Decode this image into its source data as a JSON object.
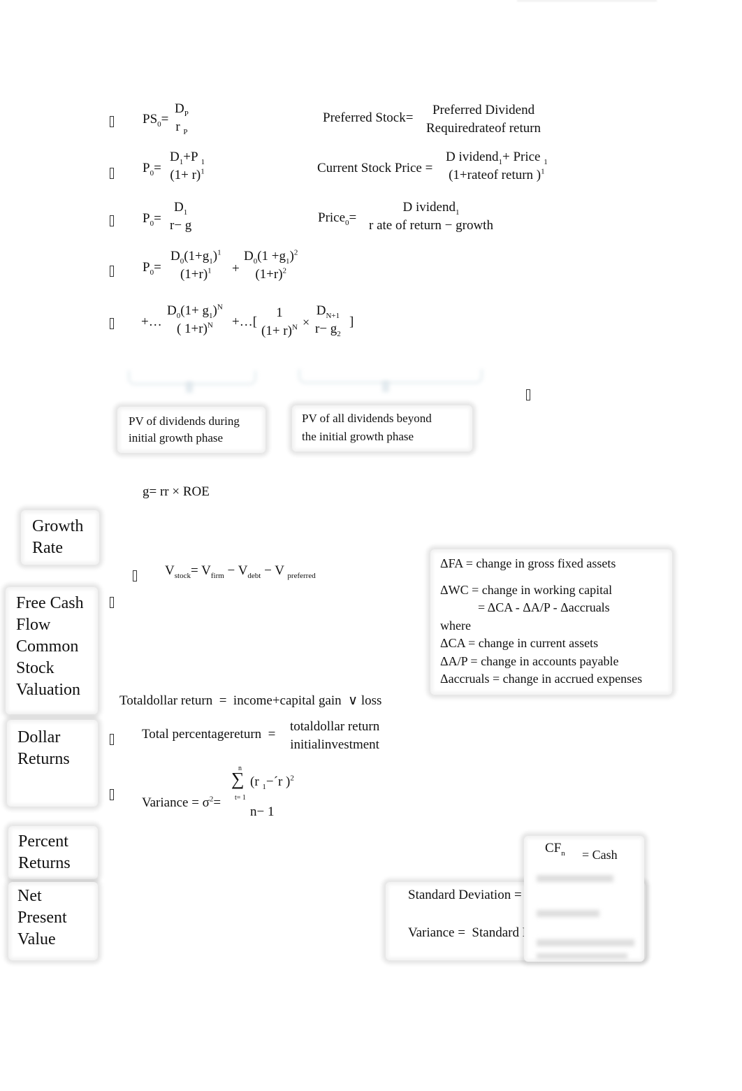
{
  "formulas": {
    "preferred_stock": {
      "lhs": "PS",
      "lhs_sub": "0",
      "eq": "=",
      "num": "D",
      "num_sub": "P",
      "den": "r",
      "den_sub": "P",
      "word_lhs": "Preferred Stock",
      "word_num": "Preferred Dividend",
      "word_den": "Requiredrateof return"
    },
    "one_period": {
      "lhs": "P",
      "lhs_sub": "0",
      "eq": "=",
      "num_a": "D",
      "num_a_sub": "1",
      "plus": "+",
      "num_b": "P",
      "num_b_sub": "1",
      "den": "(1+ r)",
      "den_sup": "1",
      "word_lhs": "Current Stock Price",
      "word_num_a": "D ividend",
      "word_num_a_sub": "1",
      "word_plus": "+",
      "word_num_b": "Price",
      "word_num_b_sub": "1",
      "word_den": "(1+rateof return )",
      "word_den_sup": "1"
    },
    "constant_growth": {
      "lhs": "P",
      "lhs_sub": "0",
      "eq": "=",
      "num": "D",
      "num_sub": "1",
      "den": "r− g",
      "word_lhs": "Price",
      "word_lhs_sub": "0",
      "word_num": "D ividend",
      "word_num_sub": "1",
      "word_den": "r ate of return − growth"
    },
    "nonconstant_1": {
      "lhs": "P",
      "lhs_sub": "0",
      "eq": "=",
      "t1_num": "D",
      "t1_num_sub": "0",
      "t1_num_rest": "(1+g",
      "t1_g_sub": "1",
      "t1_close": ")",
      "t1_sup": "1",
      "t1_den": "(1+r)",
      "t1_den_sup": "1",
      "plus": "+",
      "t2_num": "D",
      "t2_num_sub": "0",
      "t2_num_rest": "(1 +g",
      "t2_g_sub": "1",
      "t2_close": ")",
      "t2_sup": "2",
      "t2_den": "(1+r)",
      "t2_den_sup": "2"
    },
    "nonconstant_2": {
      "prefix": "+…",
      "t_num": "D",
      "t_num_sub": "0",
      "t_num_rest": "(1+ g",
      "t_g_sub": "1",
      "t_close": ")",
      "t_sup": "N",
      "t_den": "( 1+r)",
      "t_den_sup": "N",
      "mid": "+…[",
      "f_num": "1",
      "f_den": "(1+ r)",
      "f_den_sup": "N",
      "times": "×",
      "g_num": "D",
      "g_num_sub": "N+1",
      "g_den": "r− g",
      "g_den_sub": "2",
      "close": "]"
    },
    "growth_rate": {
      "text": "g= rr × ROE"
    },
    "fcf": {
      "v": "V",
      "stock": "stock",
      "eq": "=",
      "firm": "firm",
      "minus1": "−",
      "debt": "debt",
      "minus2": "−",
      "preferred": "preferred"
    },
    "total_dollar_return": {
      "text": "Totaldollar return  =  income+capital gain  ∨ loss"
    },
    "total_percentage_return": {
      "lhs": "Total percentagereturn  =",
      "num": "totaldollar return",
      "den": "initialinvestment"
    },
    "variance": {
      "lhs": "Variance = σ",
      "lhs_sup": "2",
      "eq": "=",
      "sigma": "∑",
      "sigma_top": "n",
      "sigma_bottom": "t= 1",
      "num": "(r",
      "num_sub": "1",
      "num_rest": "−´r )",
      "num_sup": "2",
      "den": "n− 1"
    },
    "std_dev": {
      "line1": "Standard Deviation =",
      "line2": "Variance =  Standard Deviation"
    },
    "cash_flow": {
      "cf": "CF",
      "cf_sub": "n",
      "eq": "= Cash"
    }
  },
  "callouts": {
    "initial_phase": {
      "line1": "PV of dividends during",
      "line2": "initial growth phase"
    },
    "beyond_phase": {
      "line1": "PV of all dividends beyond",
      "line2": "the initial growth phase"
    }
  },
  "section_labels": {
    "growth_rate": [
      "Growth",
      "Rate"
    ],
    "fcf_valuation": [
      "Free Cash",
      "Flow",
      "Common",
      "Stock",
      "Valuation"
    ],
    "dollar_returns": [
      "Dollar",
      "Returns"
    ],
    "percent_returns": [
      "Percent",
      "Returns"
    ],
    "npv": [
      "Net",
      "Present",
      "Value"
    ]
  },
  "definitions": [
    "ΔFA = change in gross fixed assets",
    "ΔWC = change in working capital",
    "            = ΔCA - ΔA/P - Δaccruals",
    "where",
    "ΔCA = change in current assets",
    "ΔA/P = change in accounts payable",
    "Δaccruals = change in accrued expenses"
  ]
}
